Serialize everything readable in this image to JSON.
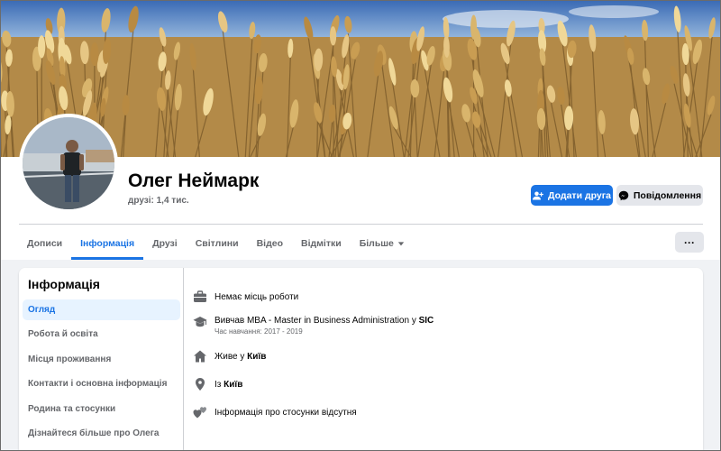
{
  "profile": {
    "name": "Олег Неймарк",
    "friends": "друзі: 1,4 тис."
  },
  "actions": {
    "add_friend": "Додати друга",
    "message": "Повідомлення",
    "more": "···"
  },
  "tabs": [
    {
      "label": "Дописи"
    },
    {
      "label": "Інформація",
      "active": true
    },
    {
      "label": "Друзі"
    },
    {
      "label": "Світлини"
    },
    {
      "label": "Відео"
    },
    {
      "label": "Відмітки"
    },
    {
      "label": "Більше"
    }
  ],
  "sidebar": {
    "title": "Інформація",
    "items": [
      {
        "label": "Огляд",
        "active": true
      },
      {
        "label": "Робота й освіта"
      },
      {
        "label": "Місця проживання"
      },
      {
        "label": "Контакти і основна інформація"
      },
      {
        "label": "Родина та стосунки"
      },
      {
        "label": "Дізнайтеся більше про Олега"
      }
    ]
  },
  "overview": {
    "work": "Немає місць роботи",
    "education_prefix": "Вивчав MBA - Master in Business Administration  у",
    "education_place": "SIC",
    "education_period": "Час навчання: 2017 - 2019",
    "lives_prefix": "Живе у",
    "lives_city": "Київ",
    "from_prefix": "Із",
    "from_city": "Київ",
    "relationship": "Інформація про стосунки відсутня"
  },
  "colors": {
    "accent": "#1b74e4",
    "secondary_button": "#e4e6eb",
    "muted_text": "#65676b",
    "active_bg": "#e7f3ff"
  },
  "icons": {
    "add_friend": "person-plus-icon",
    "message": "messenger-icon",
    "dropdown": "caret-down-icon",
    "work": "briefcase-icon",
    "education": "graduation-cap-icon",
    "lives": "home-icon",
    "from": "location-pin-icon",
    "relationship": "hearts-icon"
  }
}
